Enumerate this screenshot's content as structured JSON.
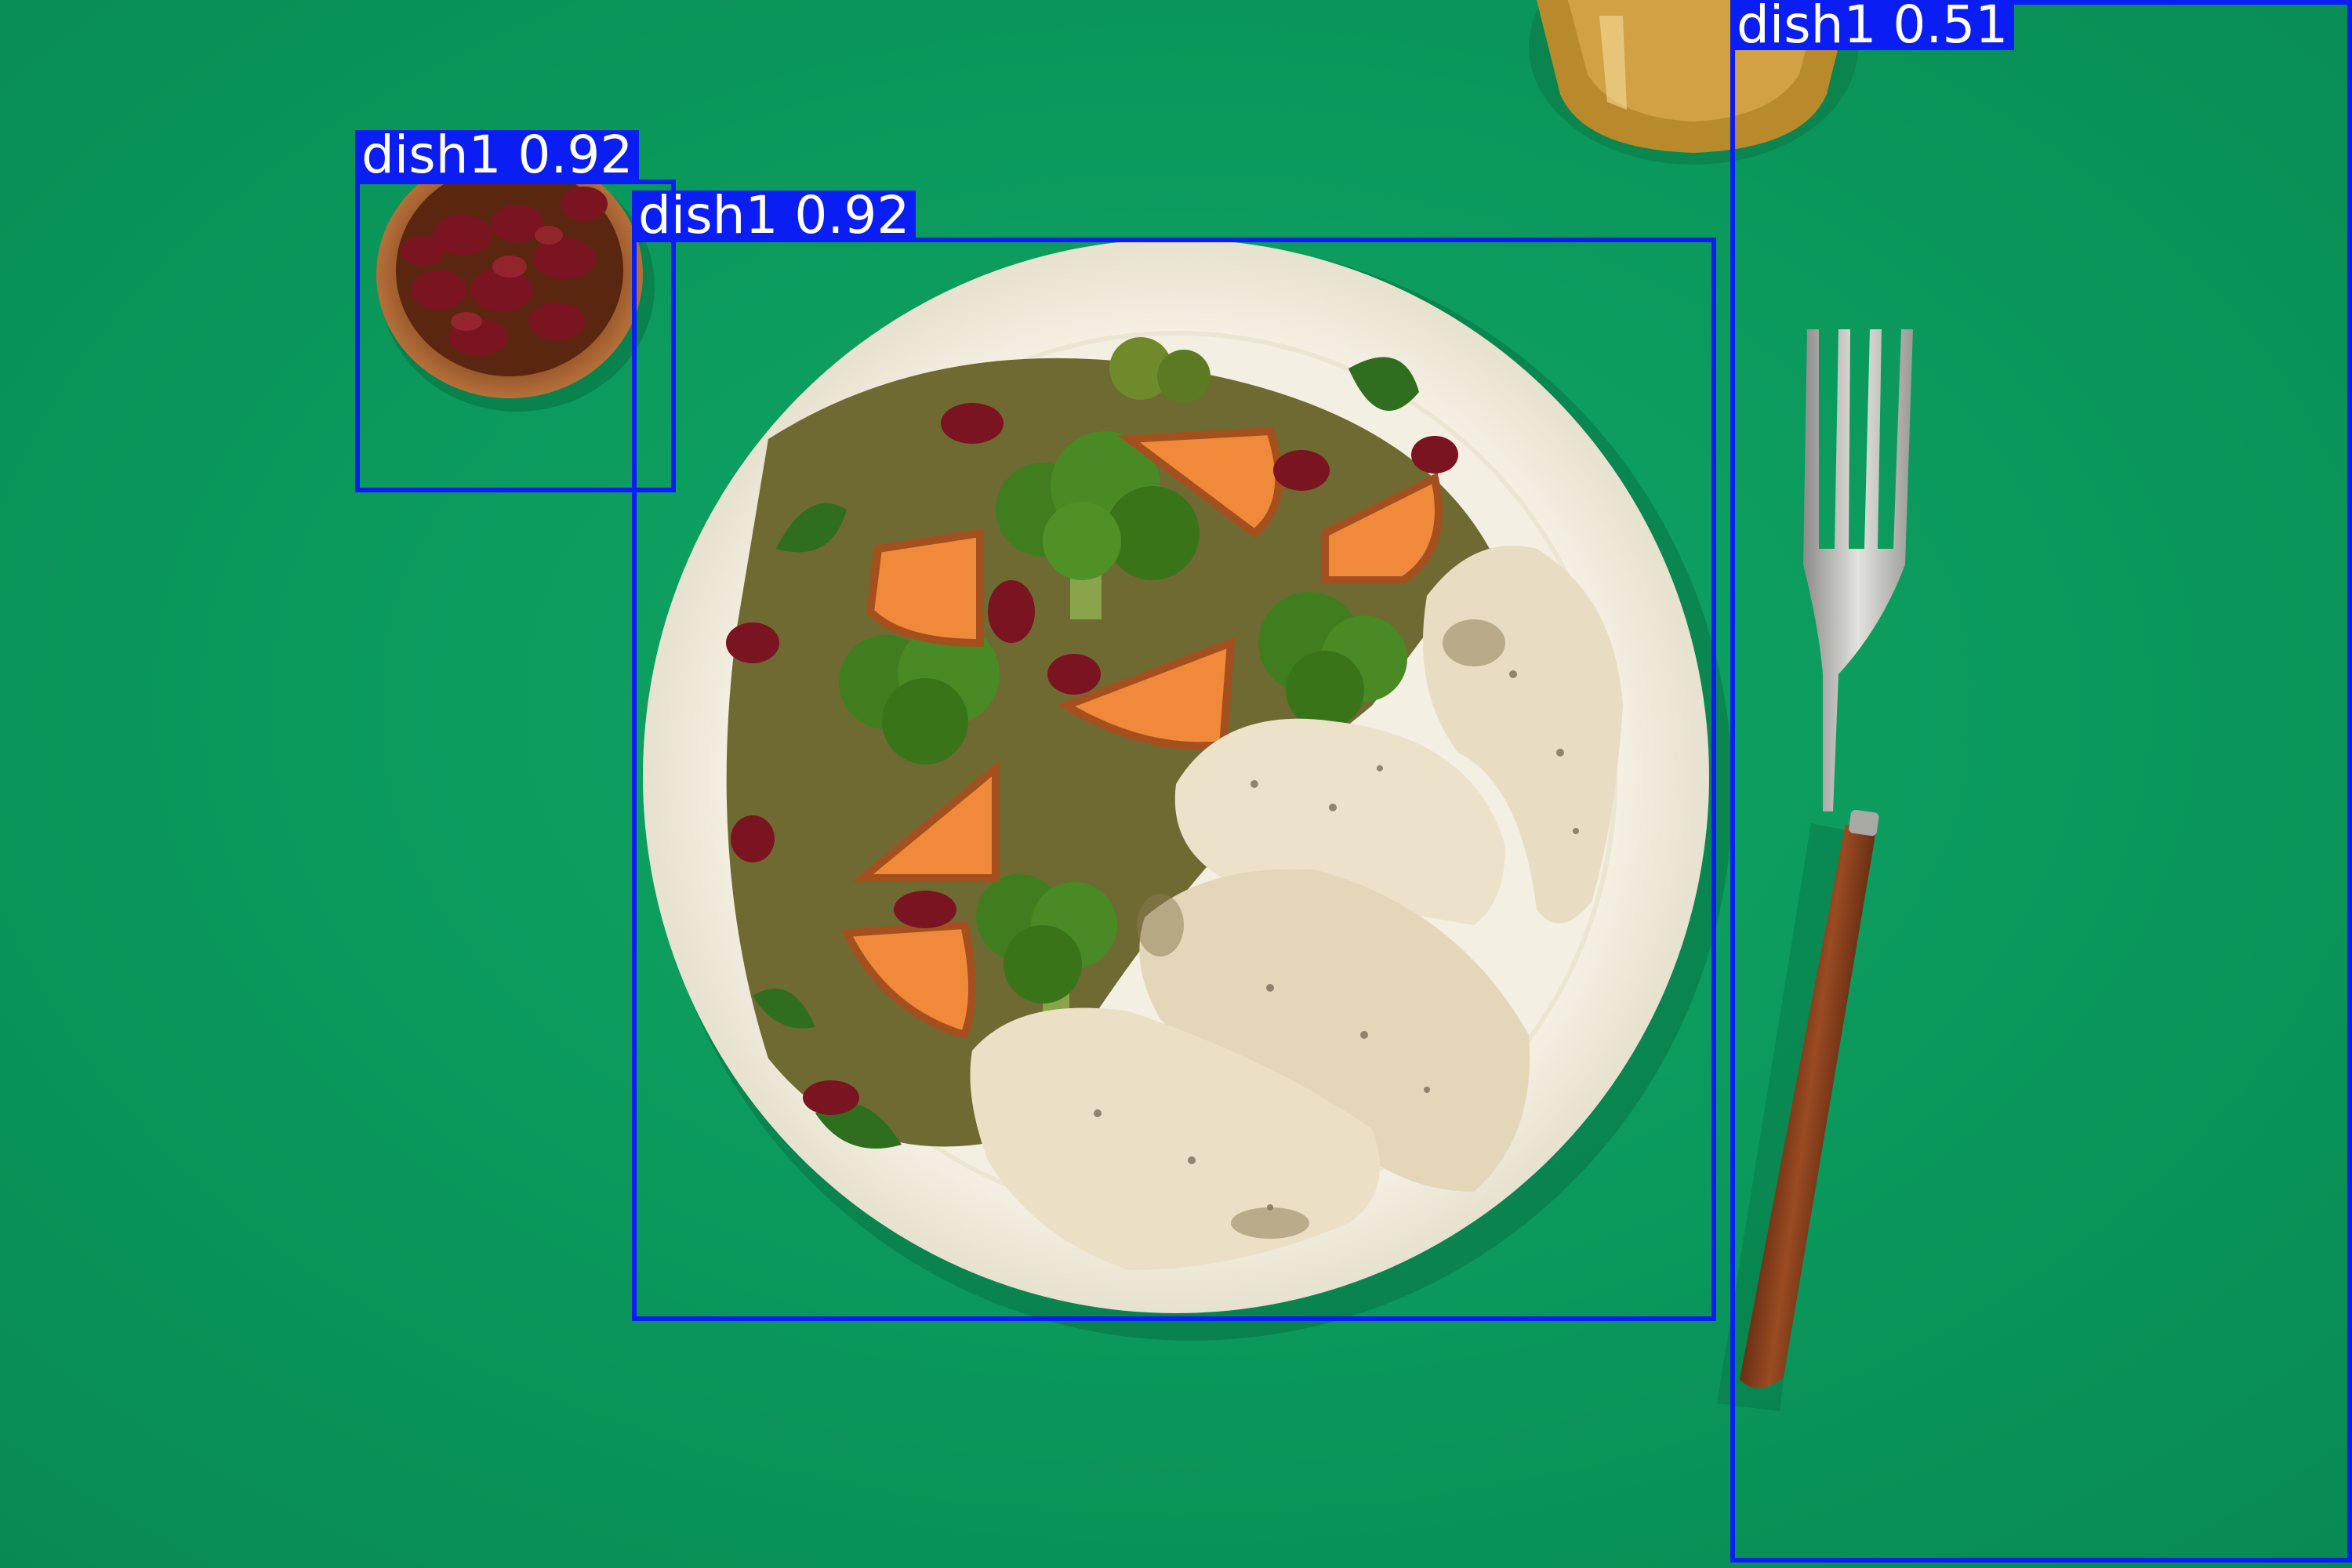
{
  "image": {
    "background_color": "#0a9a5e",
    "box_color": "#0a1df2",
    "label_text_color": "#ffffff"
  },
  "scene_objects": [
    "green tablecloth",
    "white plate with roasted chicken, broccoli, sweet potato and cranberries",
    "wooden bowl of dried cranberries",
    "fork with wooden handle",
    "glass of tea"
  ],
  "detections": [
    {
      "label": "dish1",
      "score": "0.92",
      "text": "dish1  0.92"
    },
    {
      "label": "dish1",
      "score": "0.92",
      "text": "dish1  0.92"
    },
    {
      "label": "dish1",
      "score": "0.51",
      "text": "dish1  0.51"
    }
  ]
}
